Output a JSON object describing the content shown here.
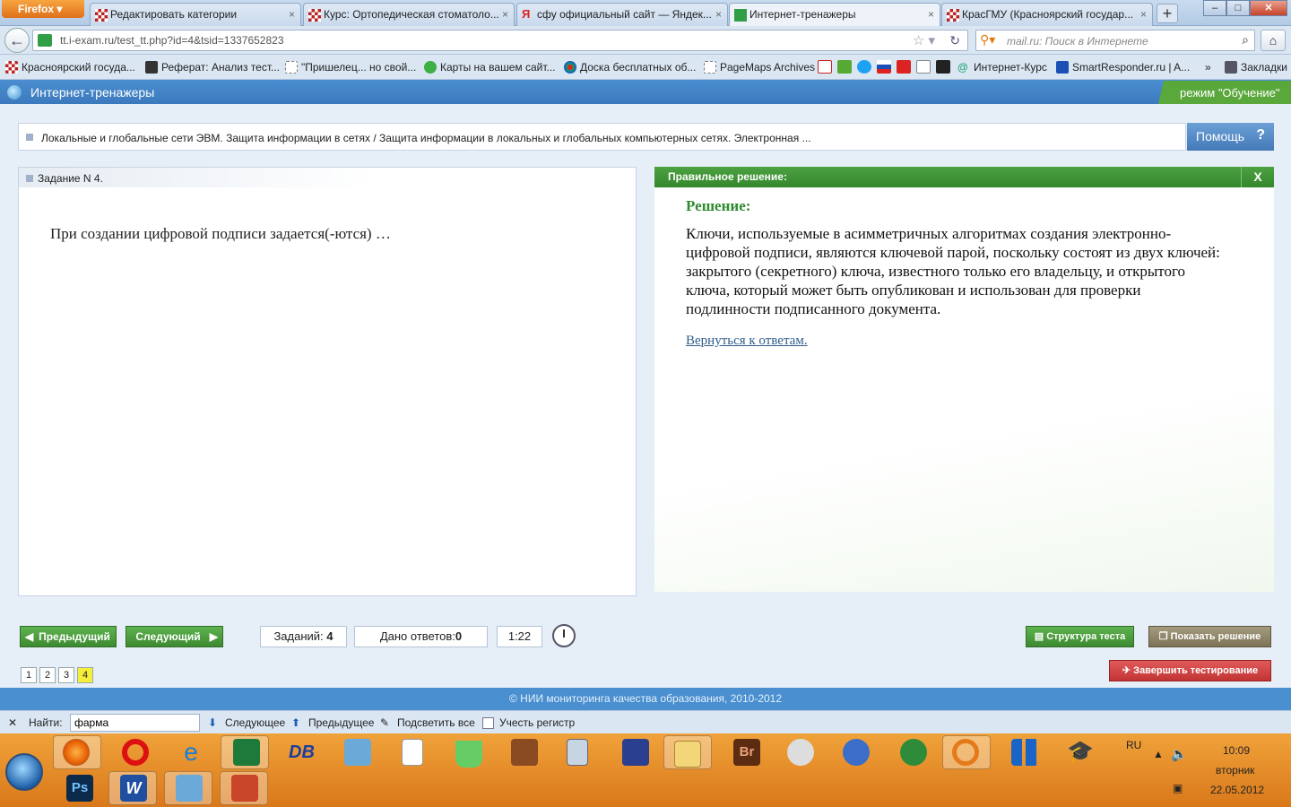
{
  "browser": {
    "menu_label": "Firefox",
    "tabs": [
      {
        "label": "Редактировать категории",
        "active": false
      },
      {
        "label": "Курс: Ортопедическая стоматоло...",
        "active": false
      },
      {
        "label": "сфу официальный сайт — Яндек...",
        "active": false
      },
      {
        "label": "Интернет-тренажеры",
        "active": true
      },
      {
        "label": "КрасГМУ (Красноярский государ...",
        "active": false
      }
    ],
    "url": "tt.i-exam.ru/test_tt.php?id=4&tsid=1337652823",
    "search_placeholder": "mail.ru: Поиск в Интернете",
    "bookmarks": [
      "Красноярский госуда...",
      "Реферат: Анализ тест...",
      "\"Пришелец... но свой...",
      "Карты на вашем сайт...",
      "Доска бесплатных об...",
      "PageMaps Archives",
      "Интернет-Курс",
      "SmartResponder.ru | A...",
      "Закладки"
    ]
  },
  "site": {
    "title": "Интернет-тренажеры",
    "mode": "режим \"Обучение\"",
    "breadcrumb": "Локальные и глобальные сети ЭВМ. Защита информации в сетях / Защита информации в локальных и глобальных компьютерных сетях. Электронная ...",
    "help_label": "Помощь",
    "help_icon": "?"
  },
  "task": {
    "number_label": "Задание N 4.",
    "question": "При создании цифровой подписи задается(-ются) …"
  },
  "solution": {
    "header": "Правильное решение:",
    "close_label": "X",
    "label": "Решение:",
    "text": "Ключи, используемые в асимметричных алгоритмах создания электронно-цифровой подписи, являются ключевой парой, поскольку состоят из двух ключей: закрытого (секретного) ключа, известного только его владельцу, и открытого ключа, который может быть опубликован и использован для проверки подлинности подписанного документа.",
    "back_link": "Вернуться к ответам."
  },
  "controls": {
    "prev_label": "Предыдущий",
    "next_label": "Следующий",
    "tasks_label": "Заданий:",
    "tasks_count": "4",
    "answers_label": "Дано ответов:",
    "answers_count": "0",
    "timer": "1:22",
    "structure_label": "Структура теста",
    "show_solution_label": "Показать решение",
    "finish_label": "Завершить тестирование",
    "pages": [
      "1",
      "2",
      "3",
      "4"
    ],
    "current_page": "4"
  },
  "footer": "© НИИ мониторинга качества образования, 2010-2012",
  "findbar": {
    "find_label": "Найти:",
    "query": "фарма",
    "next_label": "Следующее",
    "prev_label": "Предыдущее",
    "highlight_label": "Подсветить все",
    "case_label": "Учесть регистр"
  },
  "taskbar": {
    "lang": "RU",
    "time": "10:09",
    "weekday": "вторник",
    "date": "22.05.2012",
    "apps_row1": [
      "Firefox",
      "Opera",
      "Internet Explorer",
      "Excel",
      "DB",
      "Media",
      "Document",
      "Flask",
      "Paint",
      "Calculator",
      "Save",
      "Explorer",
      "Bridge",
      "Chat",
      "Globe",
      "Network",
      "Audio",
      "Tiles",
      "Graduation"
    ],
    "apps_row2": [
      "Photoshop",
      "Word",
      "Windows",
      "PowerPoint"
    ]
  }
}
